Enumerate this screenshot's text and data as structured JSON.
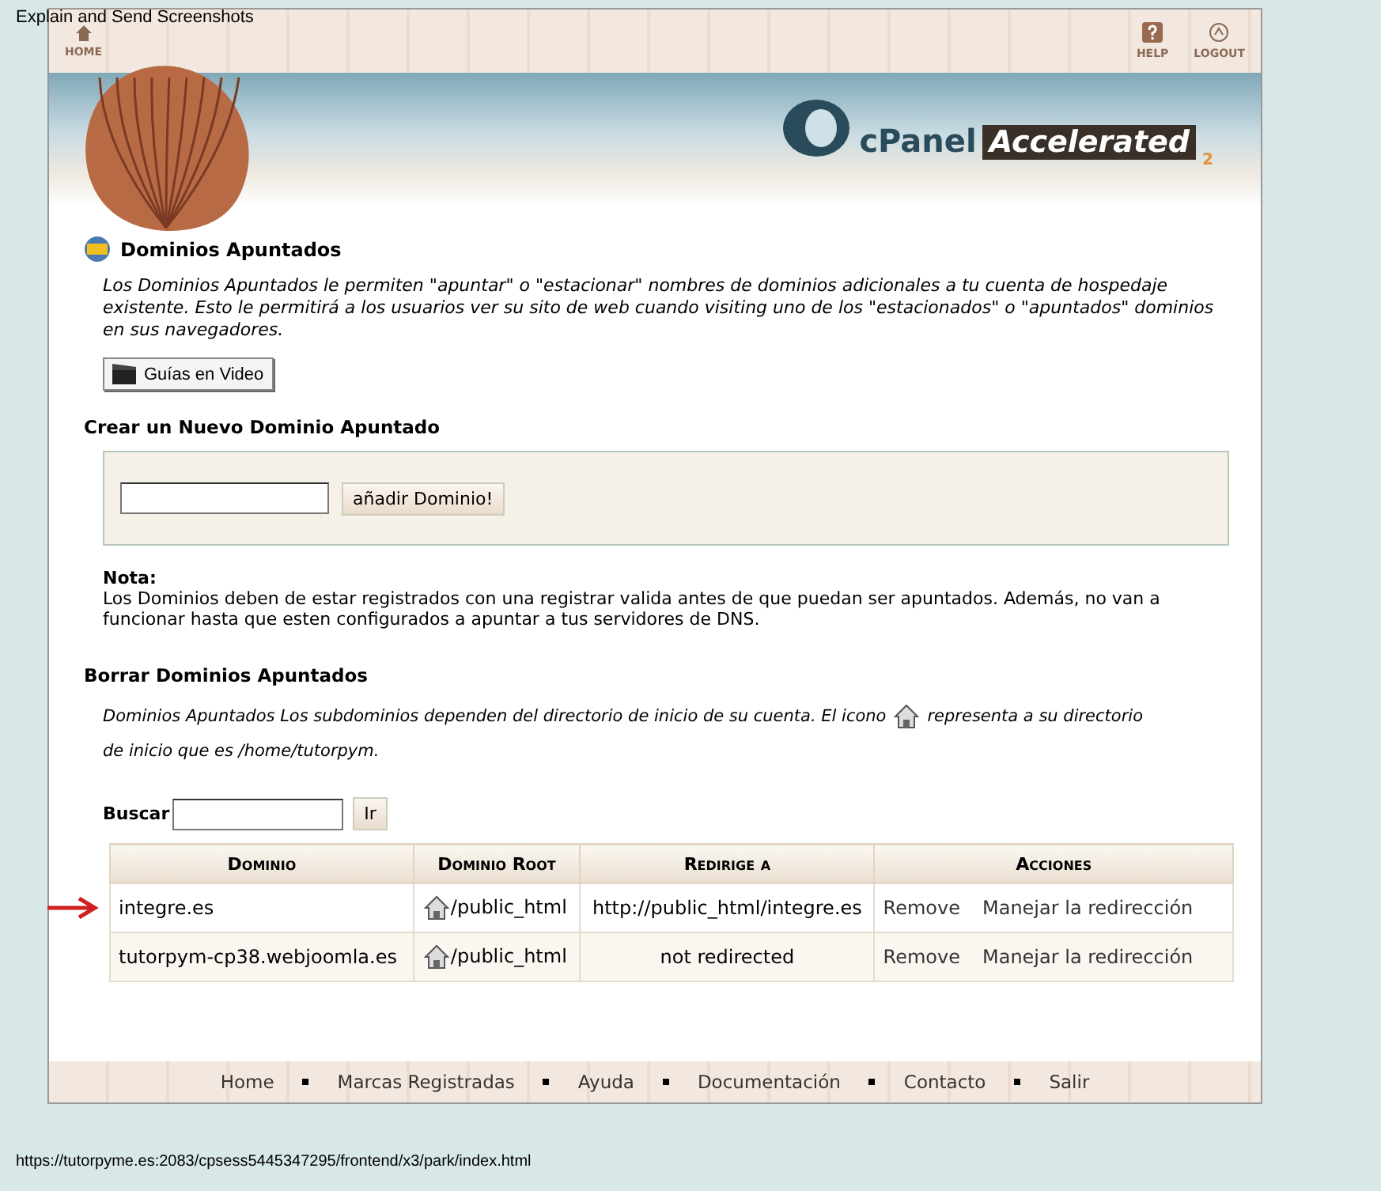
{
  "overlay_caption": "Explain and Send Screenshots",
  "header": {
    "nav_left": [
      {
        "label": "HOME",
        "kind": "home"
      }
    ],
    "nav_right": [
      {
        "label": "HELP",
        "kind": "help"
      },
      {
        "label": "LOGOUT",
        "kind": "logout"
      }
    ],
    "logo": {
      "brand": "cPanel",
      "product": "Accelerated",
      "version": "2"
    }
  },
  "page": {
    "title": "Dominios Apuntados",
    "intro": "Los Dominios Apuntados le permiten \"apuntar\" o \"estacionar\" nombres de dominios adicionales a tu cuenta de hospedaje existente. Esto le permitirá a los usuarios ver su sito de web cuando visiting uno de los \"estacionados\" o \"apuntados\" dominios en sus navegadores.",
    "video_button": "Guías en Video"
  },
  "create": {
    "heading": "Crear un Nuevo Dominio Apuntado",
    "button": "añadir Dominio!",
    "note_label": "Nota:",
    "note": "Los Dominios deben de estar registrados con una registrar valida antes de que puedan ser apuntados. Además, no van a funcionar hasta que esten configurados a apuntar a tus servidores de DNS."
  },
  "remove": {
    "heading": "Borrar Dominios Apuntados",
    "desc_before": "Dominios Apuntados Los subdominios dependen del directorio de inicio de su cuenta. El icono",
    "desc_after": "representa a su directorio",
    "desc_line2": "de inicio que es /home/tutorpym.",
    "search_label": "Buscar",
    "search_button": "Ir"
  },
  "table": {
    "columns": [
      "Dominio",
      "Dominio Root",
      "Redirige a",
      "Acciones"
    ],
    "rows": [
      {
        "domain": "integre.es",
        "root": "/public_html",
        "redirect": "http://public_html/integre.es",
        "actions": [
          "Remove",
          "Manejar la redirección"
        ]
      },
      {
        "domain": "tutorpym-cp38.webjoomla.es",
        "root": "/public_html",
        "redirect": "not redirected",
        "actions": [
          "Remove",
          "Manejar la redirección"
        ]
      }
    ]
  },
  "footer": {
    "links": [
      "Home",
      "Marcas Registradas",
      "Ayuda",
      "Documentación",
      "Contacto",
      "Salir"
    ]
  },
  "status_bar": {
    "url": "https://tutorpyme.es:2083/cpsess5445347295/frontend/x3/park/index.html"
  }
}
